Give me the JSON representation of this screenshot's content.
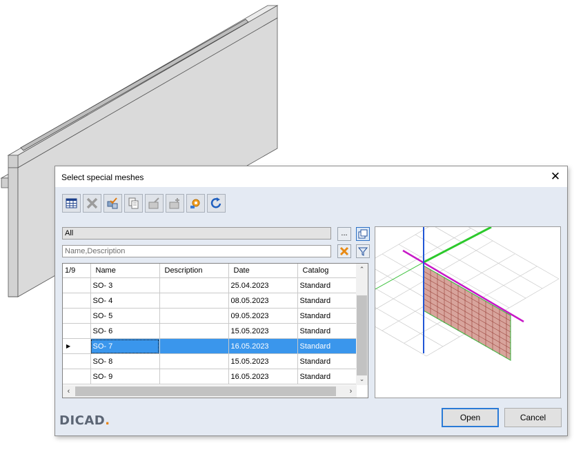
{
  "dialog": {
    "title": "Select special meshes",
    "close_glyph": "✕",
    "logo_text": "DICAD",
    "logo_dot": ".",
    "accent_color": "#3a96ec"
  },
  "toolbar": {
    "buttons": [
      {
        "icon": "table-icon"
      },
      {
        "icon": "delete-x-icon"
      },
      {
        "icon": "check-parts-icon"
      },
      {
        "icon": "copy-icon"
      },
      {
        "icon": "export-icon"
      },
      {
        "icon": "import-icon"
      },
      {
        "icon": "settings-gear-icon"
      },
      {
        "icon": "refresh-icon"
      }
    ]
  },
  "filter": {
    "category_value": "All",
    "more_label": "...",
    "search_placeholder": "Name,Description"
  },
  "grid": {
    "counter": "1/9",
    "columns": [
      "Name",
      "Description",
      "Date",
      "Catalog"
    ],
    "rows": [
      {
        "name": "SO- 3",
        "description": "",
        "date": "25.04.2023",
        "catalog": "Standard"
      },
      {
        "name": "SO- 4",
        "description": "",
        "date": "08.05.2023",
        "catalog": "Standard"
      },
      {
        "name": "SO- 5",
        "description": "",
        "date": "09.05.2023",
        "catalog": "Standard"
      },
      {
        "name": "SO- 6",
        "description": "",
        "date": "15.05.2023",
        "catalog": "Standard"
      },
      {
        "name": "SO- 7",
        "description": "",
        "date": "16.05.2023",
        "catalog": "Standard",
        "selected": true
      },
      {
        "name": "SO- 8",
        "description": "",
        "date": "15.05.2023",
        "catalog": "Standard"
      },
      {
        "name": "SO- 9",
        "description": "",
        "date": "16.05.2023",
        "catalog": "Standard"
      }
    ],
    "selected_marker": "▶"
  },
  "buttons": {
    "open_label": "Open",
    "cancel_label": "Cancel"
  }
}
